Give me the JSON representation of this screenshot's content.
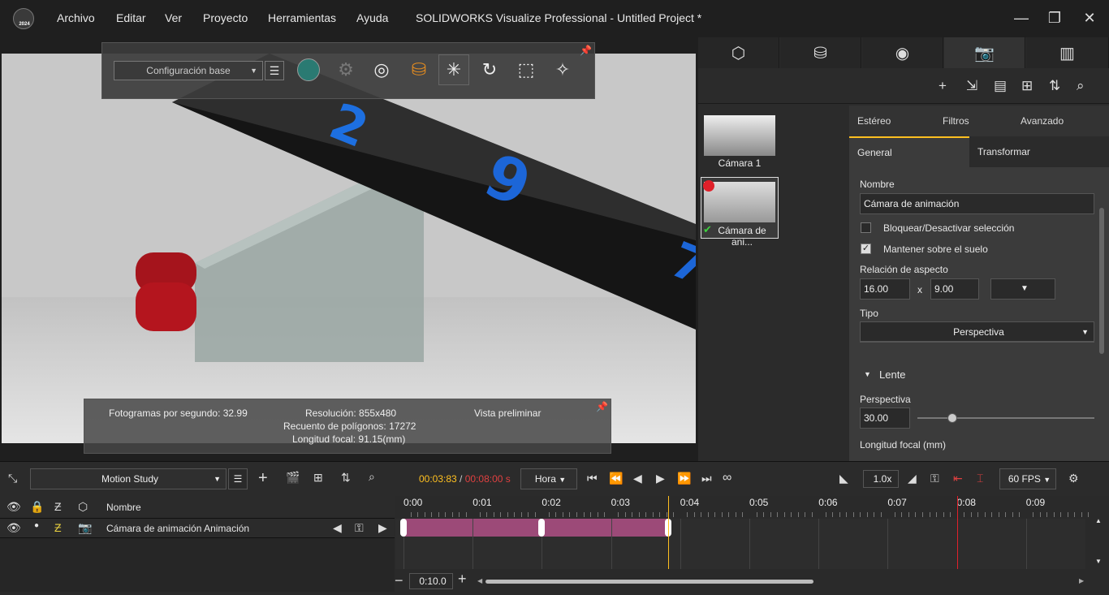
{
  "menubar": {
    "items": [
      "Archivo",
      "Editar",
      "Ver",
      "Proyecto",
      "Herramientas",
      "Ayuda"
    ],
    "title": "SOLIDWORKS Visualize Professional - Untitled Project *",
    "year": "2024"
  },
  "toolbar": {
    "config": "Configuración base"
  },
  "info": {
    "fps": "Fotogramas por segundo: 32.99",
    "resolution": "Resolución: 855x480",
    "polygons": "Recuento de polígonos: 17272",
    "focal": "Longitud focal: 91.15(mm)",
    "preview": "Vista preliminar"
  },
  "cameras": [
    {
      "label": "Cámara 1"
    },
    {
      "label": "Cámara de ani..."
    }
  ],
  "props": {
    "tabs_top": [
      "Estéreo",
      "Filtros",
      "Avanzado"
    ],
    "tabs": [
      "General",
      "Transformar"
    ],
    "name_label": "Nombre",
    "name_value": "Cámara de animación",
    "lock_label": "Bloquear/Desactivar selección",
    "keep_label": "Mantener sobre el suelo",
    "aspect_label": "Relación de aspecto",
    "aspect_w": "16.00",
    "aspect_x": "x",
    "aspect_h": "9.00",
    "type_label": "Tipo",
    "type_value": "Perspectiva",
    "lens_label": "Lente",
    "persp_label": "Perspectiva",
    "persp_value": "30.00",
    "persp_slider": 0.05,
    "focal_label": "Longitud focal (mm)"
  },
  "timeline": {
    "study": "Motion Study",
    "time_current": "00:03:83",
    "time_sep": " / ",
    "time_total": "00:08:00 s",
    "unit": "Hora",
    "speed": "1.0x",
    "fps": "60 FPS",
    "col_name": "Nombre",
    "track": "Cámara de animación Animación",
    "zoom": "0:10.0",
    "ticks": [
      "0:00",
      "0:01",
      "0:02",
      "0:03",
      "0:04",
      "0:05",
      "0:06",
      "0:07",
      "0:08",
      "0:09"
    ],
    "playhead_s": 3.83,
    "end_s": 8.0
  },
  "colors": {
    "accent": "#ffc020",
    "track": "#9c4a78",
    "endmarker": "#e0202a"
  }
}
